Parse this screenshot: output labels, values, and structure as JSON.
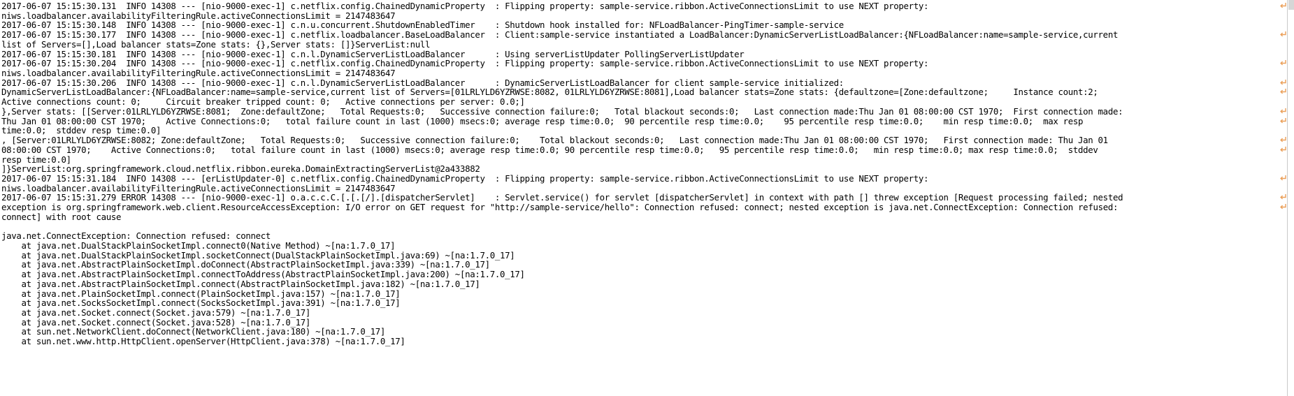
{
  "console": {
    "title": "Run console output",
    "font_color": "#000000",
    "background_color": "#ffffff",
    "wrap_marker_color": "#eba05a",
    "scrollbar_thumb_color": "#d6d6d6",
    "wrap_marker_icon": "soft-wrap-return-arrow-icon",
    "scrollbar_orientation": "vertical"
  },
  "lines": [
    {
      "id": 0,
      "text": "2017-06-07 15:15:30.131  INFO 14308 --- [nio-9000-exec-1] c.netflix.config.ChainedDynamicProperty  : Flipping property: sample-service.ribbon.ActiveConnectionsLimit to use NEXT property:",
      "wrapped": true
    },
    {
      "id": 1,
      "text": "niws.loadbalancer.availabilityFilteringRule.activeConnectionsLimit = 2147483647",
      "wrapped": false
    },
    {
      "id": 2,
      "text": "2017-06-07 15:15:30.148  INFO 14308 --- [nio-9000-exec-1] c.n.u.concurrent.ShutdownEnabledTimer    : Shutdown hook installed for: NFLoadBalancer-PingTimer-sample-service",
      "wrapped": false
    },
    {
      "id": 3,
      "text": "2017-06-07 15:15:30.177  INFO 14308 --- [nio-9000-exec-1] c.netflix.loadbalancer.BaseLoadBalancer  : Client:sample-service instantiated a LoadBalancer:DynamicServerListLoadBalancer:{NFLoadBalancer:name=sample-service,current",
      "wrapped": true
    },
    {
      "id": 4,
      "text": "list of Servers=[],Load balancer stats=Zone stats: {},Server stats: []}ServerList:null",
      "wrapped": false
    },
    {
      "id": 5,
      "text": "2017-06-07 15:15:30.181  INFO 14308 --- [nio-9000-exec-1] c.n.l.DynamicServerListLoadBalancer      : Using serverListUpdater PollingServerListUpdater",
      "wrapped": false
    },
    {
      "id": 6,
      "text": "2017-06-07 15:15:30.204  INFO 14308 --- [nio-9000-exec-1] c.netflix.config.ChainedDynamicProperty  : Flipping property: sample-service.ribbon.ActiveConnectionsLimit to use NEXT property:",
      "wrapped": true
    },
    {
      "id": 7,
      "text": "niws.loadbalancer.availabilityFilteringRule.activeConnectionsLimit = 2147483647",
      "wrapped": false
    },
    {
      "id": 8,
      "text": "2017-06-07 15:15:30.206  INFO 14308 --- [nio-9000-exec-1] c.n.l.DynamicServerListLoadBalancer      : DynamicServerListLoadBalancer for client sample-service initialized:",
      "wrapped": true
    },
    {
      "id": 9,
      "text": "DynamicServerListLoadBalancer:{NFLoadBalancer:name=sample-service,current list of Servers=[01LRLYLD6YZRWSE:8082, 01LRLYLD6YZRWSE:8081],Load balancer stats=Zone stats: {defaultzone=[Zone:defaultzone;     Instance count:2;",
      "wrapped": true
    },
    {
      "id": 10,
      "text": "Active connections count: 0;     Circuit breaker tripped count: 0;   Active connections per server: 0.0;]",
      "wrapped": false
    },
    {
      "id": 11,
      "text": "},Server stats: [[Server:01LRLYLD6YZRWSE:8081;  Zone:defaultZone;   Total Requests:0;   Successive connection failure:0;   Total blackout seconds:0;   Last connection made:Thu Jan 01 08:00:00 CST 1970;  First connection made:",
      "wrapped": true
    },
    {
      "id": 12,
      "text": "Thu Jan 01 08:00:00 CST 1970;    Active Connections:0;   total failure count in last (1000) msecs:0; average resp time:0.0;  90 percentile resp time:0.0;    95 percentile resp time:0.0;    min resp time:0.0;  max resp",
      "wrapped": true
    },
    {
      "id": 13,
      "text": "time:0.0;  stddev resp time:0.0]",
      "wrapped": false
    },
    {
      "id": 14,
      "text": ", [Server:01LRLYLD6YZRWSE:8082; Zone:defaultZone;   Total Requests:0;   Successive connection failure:0;    Total blackout seconds:0;   Last connection made:Thu Jan 01 08:00:00 CST 1970;   First connection made: Thu Jan 01",
      "wrapped": true
    },
    {
      "id": 15,
      "text": "08:00:00 CST 1970;    Active Connections:0;   total failure count in last (1000) msecs:0; average resp time:0.0; 90 percentile resp time:0.0;   95 percentile resp time:0.0;   min resp time:0.0; max resp time:0.0;  stddev",
      "wrapped": true
    },
    {
      "id": 16,
      "text": "resp time:0.0]",
      "wrapped": false
    },
    {
      "id": 17,
      "text": "]}ServerList:org.springframework.cloud.netflix.ribbon.eureka.DomainExtractingServerList@2a433882",
      "wrapped": false
    },
    {
      "id": 18,
      "text": "2017-06-07 15:15:31.184  INFO 14308 --- [erListUpdater-0] c.netflix.config.ChainedDynamicProperty  : Flipping property: sample-service.ribbon.ActiveConnectionsLimit to use NEXT property:",
      "wrapped": true
    },
    {
      "id": 19,
      "text": "niws.loadbalancer.availabilityFilteringRule.activeConnectionsLimit = 2147483647",
      "wrapped": false
    },
    {
      "id": 20,
      "text": "2017-06-07 15:15:31.279 ERROR 14308 --- [nio-9000-exec-1] o.a.c.c.C.[.[.[/].[dispatcherServlet]    : Servlet.service() for servlet [dispatcherServlet] in context with path [] threw exception [Request processing failed; nested",
      "wrapped": true
    },
    {
      "id": 21,
      "text": "exception is org.springframework.web.client.ResourceAccessException: I/O error on GET request for \"http://sample-service/hello\": Connection refused: connect; nested exception is java.net.ConnectException: Connection refused:",
      "wrapped": true,
      "link": {
        "text": "http://sample-service/hello",
        "underlined": true
      }
    },
    {
      "id": 22,
      "text": "connect] with root cause",
      "wrapped": false
    },
    {
      "id": 23,
      "text": "",
      "wrapped": false
    },
    {
      "id": 24,
      "text": "java.net.ConnectException: Connection refused: connect",
      "wrapped": false
    },
    {
      "id": 25,
      "text": "    at java.net.DualStackPlainSocketImpl.connect0(Native Method) ~[na:1.7.0_17]",
      "wrapped": false
    },
    {
      "id": 26,
      "text": "    at java.net.DualStackPlainSocketImpl.socketConnect(DualStackPlainSocketImpl.java:69) ~[na:1.7.0_17]",
      "wrapped": false
    },
    {
      "id": 27,
      "text": "    at java.net.AbstractPlainSocketImpl.doConnect(AbstractPlainSocketImpl.java:339) ~[na:1.7.0_17]",
      "wrapped": false
    },
    {
      "id": 28,
      "text": "    at java.net.AbstractPlainSocketImpl.connectToAddress(AbstractPlainSocketImpl.java:200) ~[na:1.7.0_17]",
      "wrapped": false
    },
    {
      "id": 29,
      "text": "    at java.net.AbstractPlainSocketImpl.connect(AbstractPlainSocketImpl.java:182) ~[na:1.7.0_17]",
      "wrapped": false
    },
    {
      "id": 30,
      "text": "    at java.net.PlainSocketImpl.connect(PlainSocketImpl.java:157) ~[na:1.7.0_17]",
      "wrapped": false
    },
    {
      "id": 31,
      "text": "    at java.net.SocksSocketImpl.connect(SocksSocketImpl.java:391) ~[na:1.7.0_17]",
      "wrapped": false
    },
    {
      "id": 32,
      "text": "    at java.net.Socket.connect(Socket.java:579) ~[na:1.7.0_17]",
      "wrapped": false
    },
    {
      "id": 33,
      "text": "    at java.net.Socket.connect(Socket.java:528) ~[na:1.7.0_17]",
      "wrapped": false
    },
    {
      "id": 34,
      "text": "    at sun.net.NetworkClient.doConnect(NetworkClient.java:180) ~[na:1.7.0_17]",
      "wrapped": false
    },
    {
      "id": 35,
      "text": "    at sun.net.www.http.HttpClient.openServer(HttpClient.java:378) ~[na:1.7.0_17]",
      "wrapped": false
    }
  ]
}
